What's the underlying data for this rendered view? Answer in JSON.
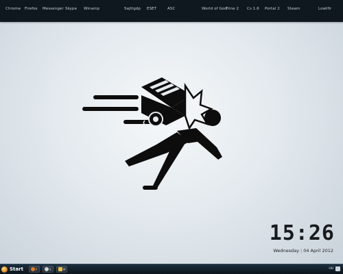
{
  "launcher": {
    "left_items": [
      "Chrome",
      "Firefox",
      "Messenger",
      "Skype",
      "Winamp"
    ],
    "center_items": [
      "Sajttgdp",
      "ESET",
      "ASC"
    ],
    "right_items": [
      "World of Goo",
      "Trine 2",
      "Cs 1.6",
      "Portal 2",
      "Steam"
    ],
    "far_right": "Lowtfir"
  },
  "clock": {
    "time": "15:26",
    "weekday": "Wednesday",
    "date": "04 April 2012"
  },
  "taskbar": {
    "start_label": "Start",
    "buttons": [
      {
        "icon": "firefox-icon",
        "label": "F"
      },
      {
        "icon": "checkmark-icon",
        "label": "S"
      },
      {
        "icon": "folder-icon",
        "label": "M"
      }
    ],
    "tray_text": "HU"
  },
  "colors": {
    "topbar": "#10181f",
    "taskbar": "#132332",
    "art": "#0d0d0d",
    "clock": "#171b1e"
  }
}
